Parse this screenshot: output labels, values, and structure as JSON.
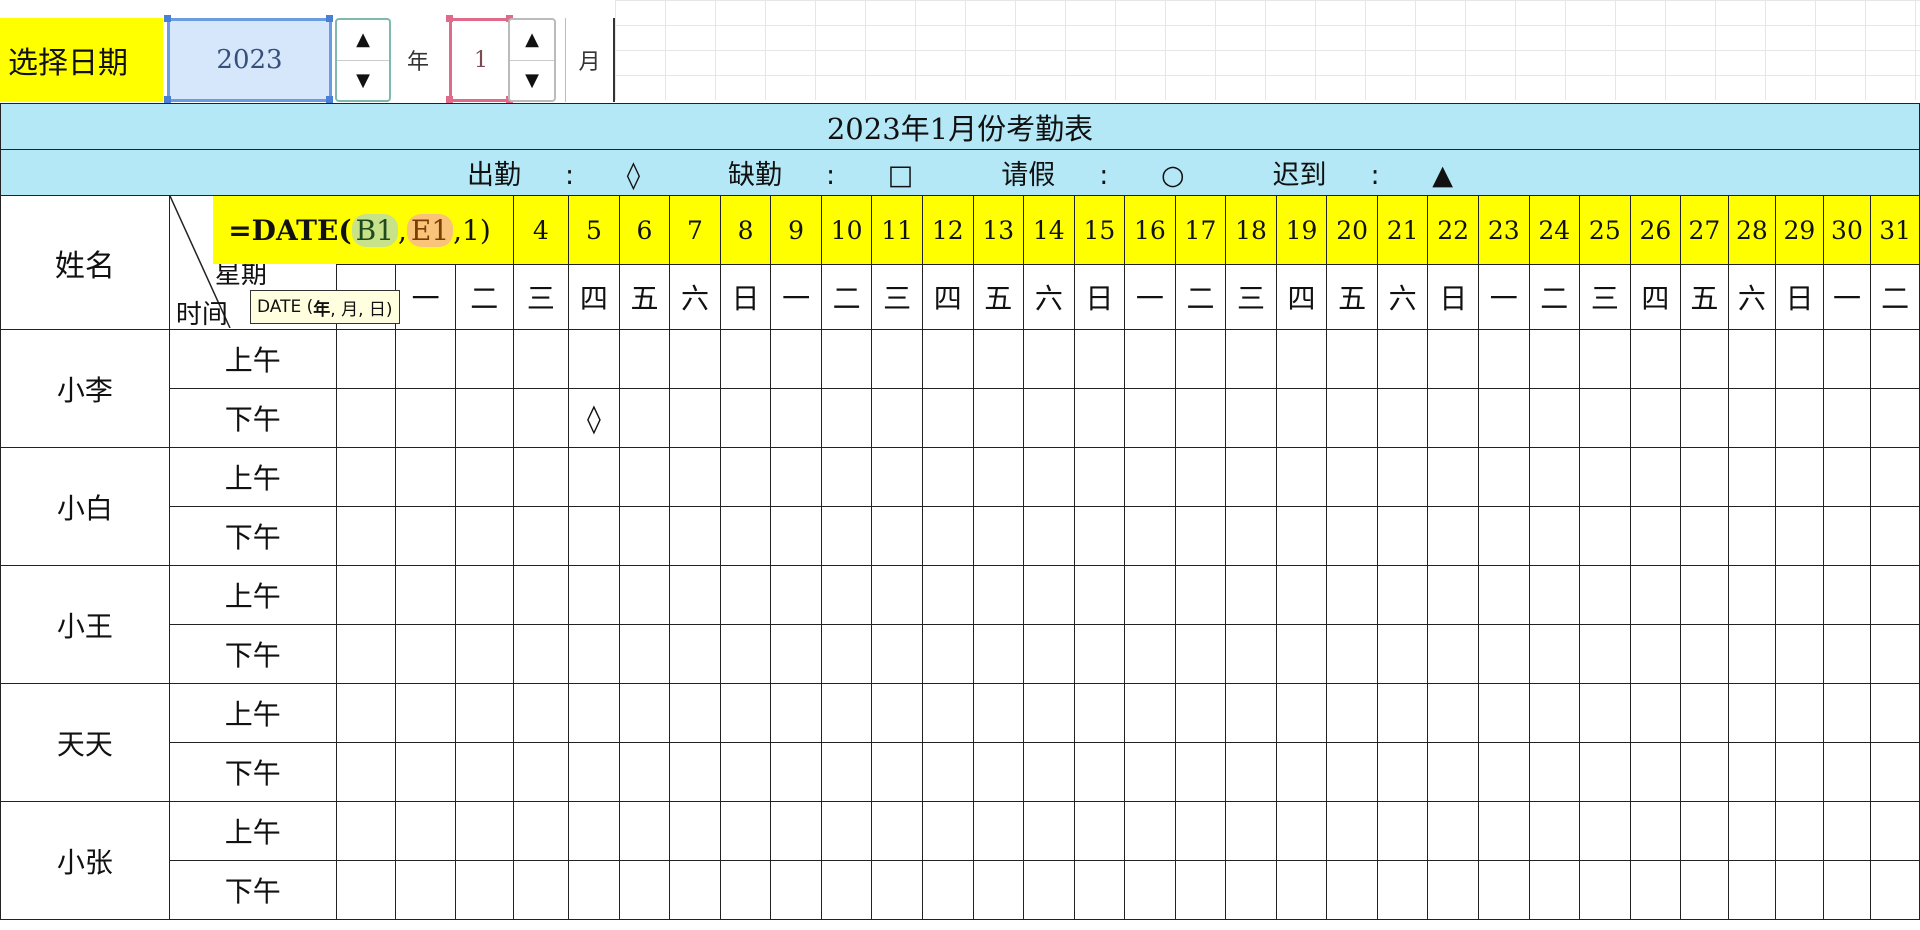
{
  "selector": {
    "label": "选择日期",
    "year_value": "2023",
    "year_unit": "年",
    "month_value": "1",
    "month_unit": "月",
    "spin_up": "▲",
    "spin_down": "▼"
  },
  "sheet": {
    "title": "2023年1月份考勤表",
    "legend": [
      {
        "label": "出勤",
        "symbol": "◊"
      },
      {
        "label": "缺勤",
        "symbol": "□"
      },
      {
        "label": "请假",
        "symbol": "○"
      },
      {
        "label": "迟到",
        "symbol": "▲"
      }
    ],
    "legend_separator": ":",
    "name_header": "姓名",
    "diag_week": "星期",
    "diag_time": "时间",
    "dates": [
      "",
      "",
      "",
      "4",
      "5",
      "6",
      "7",
      "8",
      "9",
      "10",
      "11",
      "12",
      "13",
      "14",
      "15",
      "16",
      "17",
      "18",
      "19",
      "20",
      "21",
      "22",
      "23",
      "24",
      "25",
      "26",
      "27",
      "28",
      "29",
      "30",
      "31"
    ],
    "weekdays": [
      "",
      "一",
      "二",
      "三",
      "四",
      "五",
      "六",
      "日",
      "一",
      "二",
      "三",
      "四",
      "五",
      "六",
      "日",
      "一",
      "二",
      "三",
      "四",
      "五",
      "六",
      "日",
      "一",
      "二",
      "三",
      "四",
      "五",
      "六",
      "日",
      "一",
      "二"
    ],
    "employees": [
      {
        "name": "小李",
        "am": "上午",
        "pm": "下午"
      },
      {
        "name": "小白",
        "am": "上午",
        "pm": "下午"
      },
      {
        "name": "小王",
        "am": "上午",
        "pm": "下午"
      },
      {
        "name": "天天",
        "am": "上午",
        "pm": "下午"
      },
      {
        "name": "小张",
        "am": "上午",
        "pm": "下午"
      }
    ],
    "marks": [
      {
        "employee": 0,
        "period": "pm",
        "day": "5",
        "symbol": "◊"
      }
    ]
  },
  "formula": {
    "prefix": "=DATE(",
    "ref1": "B1",
    "sep1": ",",
    "ref2": "E1",
    "suffix": ",1)"
  },
  "tooltip": {
    "fn": "DATE (",
    "arg1": "年",
    "rest": ", 月, 日)"
  }
}
